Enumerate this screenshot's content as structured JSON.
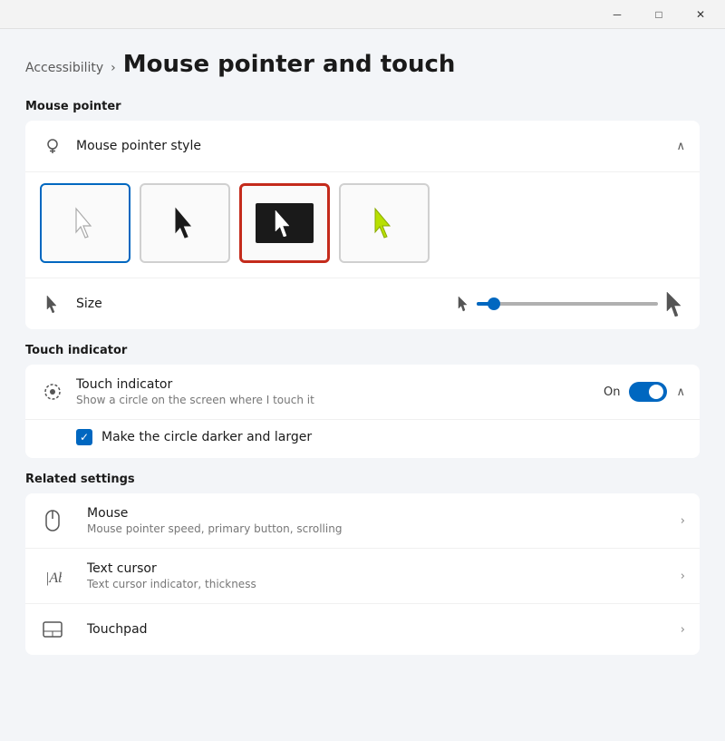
{
  "titlebar": {
    "minimize_label": "─",
    "maximize_label": "□",
    "close_label": "✕"
  },
  "header": {
    "breadcrumb": "Accessibility",
    "separator": "›",
    "title": "Mouse pointer and touch"
  },
  "mouse_pointer_section": {
    "label": "Mouse pointer",
    "pointer_style_row": {
      "icon": "🖱",
      "title": "Mouse pointer style",
      "expanded": true
    },
    "pointer_options": [
      {
        "id": "white",
        "selected": "blue",
        "label": "White cursor"
      },
      {
        "id": "black",
        "selected": "none",
        "label": "Black cursor"
      },
      {
        "id": "inverted",
        "selected": "red",
        "label": "Inverted cursor"
      },
      {
        "id": "color",
        "selected": "none",
        "label": "Color cursor"
      }
    ],
    "size_row": {
      "label": "Size",
      "slider_value": 8
    }
  },
  "touch_indicator_section": {
    "label": "Touch indicator",
    "touch_row": {
      "title": "Touch indicator",
      "subtitle": "Show a circle on the screen where I touch it",
      "toggle_label": "On",
      "toggle_on": true,
      "expanded": true
    },
    "checkbox_row": {
      "checked": true,
      "label": "Make the circle darker and larger"
    }
  },
  "related_settings_section": {
    "label": "Related settings",
    "items": [
      {
        "icon": "mouse",
        "title": "Mouse",
        "subtitle": "Mouse pointer speed, primary button, scrolling"
      },
      {
        "icon": "text",
        "title": "Text cursor",
        "subtitle": "Text cursor indicator, thickness"
      },
      {
        "icon": "touchpad",
        "title": "Touchpad",
        "subtitle": ""
      }
    ]
  }
}
